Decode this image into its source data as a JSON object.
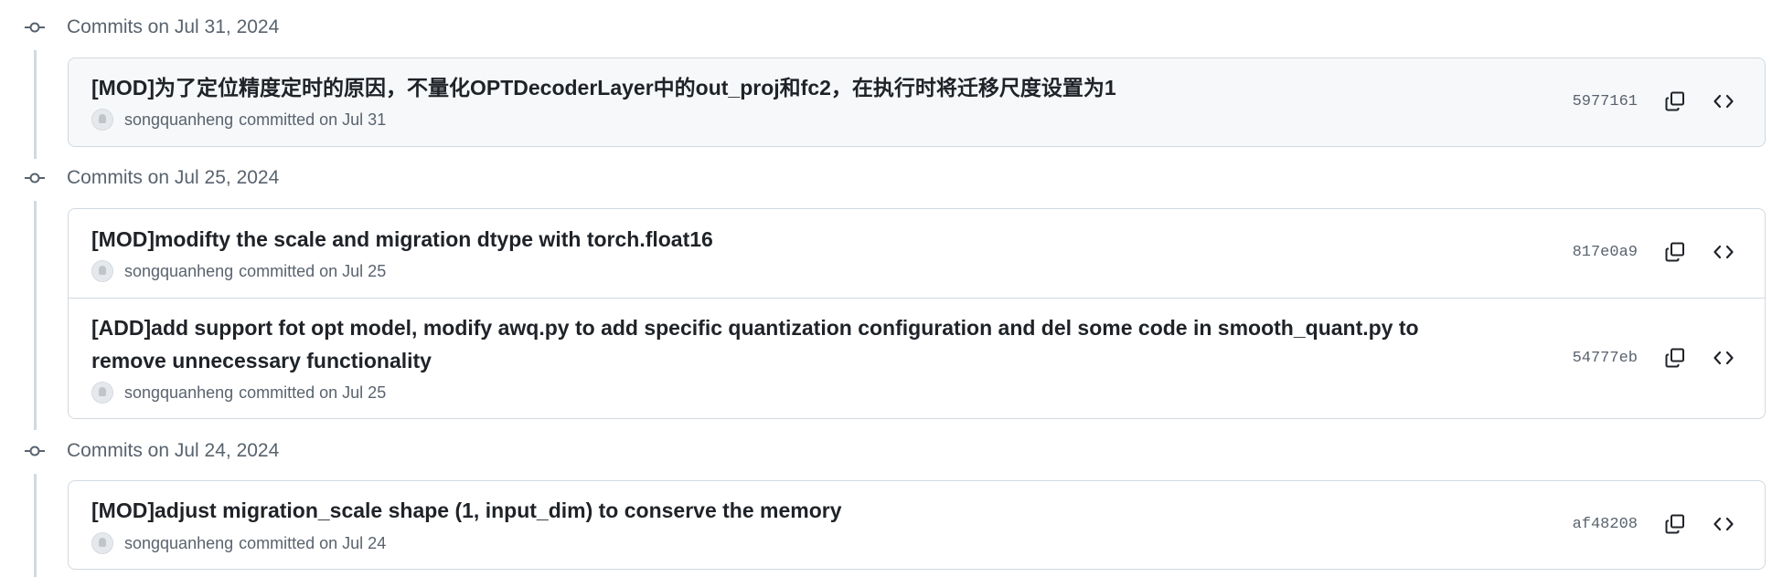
{
  "groups": [
    {
      "title": "Commits on Jul 31, 2024",
      "commits": [
        {
          "message": "[MOD]为了定位精度定时的原因，不量化OPTDecoderLayer中的out_proj和fc2，在执行时将迁移尺度设置为1",
          "author": "songquanheng",
          "committed_label": "committed on Jul 31",
          "sha": "5977161"
        }
      ]
    },
    {
      "title": "Commits on Jul 25, 2024",
      "commits": [
        {
          "message": "[MOD]modifty the scale and migration dtype with torch.float16",
          "author": "songquanheng",
          "committed_label": "committed on Jul 25",
          "sha": "817e0a9"
        },
        {
          "message": "[ADD]add support fot opt model, modify awq.py to add specific quantization configuration and del some code in smooth_quant.py to remove unnecessary functionality",
          "author": "songquanheng",
          "committed_label": "committed on Jul 25",
          "sha": "54777eb"
        }
      ]
    },
    {
      "title": "Commits on Jul 24, 2024",
      "commits": [
        {
          "message": "[MOD]adjust migration_scale shape (1, input_dim) to conserve the memory",
          "author": "songquanheng",
          "committed_label": "committed on Jul 24",
          "sha": "af48208"
        }
      ]
    }
  ],
  "icons": {
    "timeline": "git-commit-icon",
    "copy": "copy-icon",
    "browse": "code-icon",
    "avatar": "avatar-icon"
  },
  "colors": {
    "text": "#1f2328",
    "muted": "#59636e",
    "border": "#d1d9e0",
    "highlight_bg": "#f6f8fa"
  }
}
